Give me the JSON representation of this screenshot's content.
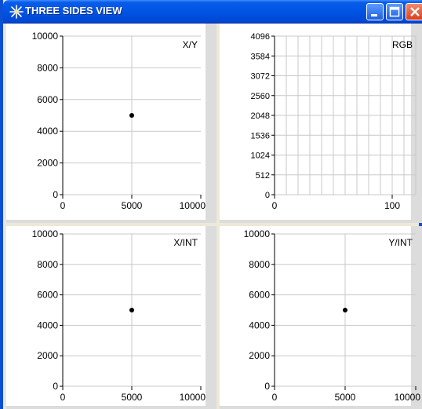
{
  "window": {
    "title": "THREE SIDES VIEW",
    "accent_color": "#0055e5",
    "panel_bg": "#ece9d8",
    "icons": {
      "app": "sparkle-icon",
      "minimize": "minimize-icon",
      "maximize": "maximize-icon",
      "close": "close-icon"
    }
  },
  "chart_data": [
    {
      "type": "scatter",
      "title": "X/Y",
      "xlim": [
        0,
        10000
      ],
      "ylim": [
        0,
        10000
      ],
      "xticks": [
        "0",
        "5000",
        "10000"
      ],
      "yticks": [
        "0",
        "2000",
        "4000",
        "6000",
        "8000",
        "10000"
      ],
      "points": [
        {
          "x": 5000,
          "y": 5000
        }
      ],
      "grid": true
    },
    {
      "type": "line",
      "title": "RGB",
      "xlim": [
        0,
        120
      ],
      "ylim": [
        0,
        4096
      ],
      "xticks": [
        "0",
        "100"
      ],
      "yticks": [
        "0",
        "512",
        "1024",
        "1536",
        "2048",
        "2560",
        "3072",
        "3584",
        "4096"
      ],
      "series": [],
      "grid": true
    },
    {
      "type": "scatter",
      "title": "X/INT",
      "xlim": [
        0,
        10000
      ],
      "ylim": [
        0,
        10000
      ],
      "xticks": [
        "0",
        "5000",
        "10000"
      ],
      "yticks": [
        "0",
        "2000",
        "4000",
        "6000",
        "8000",
        "10000"
      ],
      "points": [
        {
          "x": 5000,
          "y": 5000
        }
      ],
      "grid": true
    },
    {
      "type": "scatter",
      "title": "Y/INT",
      "xlim": [
        0,
        10000
      ],
      "ylim": [
        0,
        10000
      ],
      "xticks": [
        "0",
        "5000",
        "10000"
      ],
      "yticks": [
        "0",
        "2000",
        "4000",
        "6000",
        "8000",
        "10000"
      ],
      "points": [
        {
          "x": 5000,
          "y": 5000
        }
      ],
      "grid": true
    }
  ]
}
